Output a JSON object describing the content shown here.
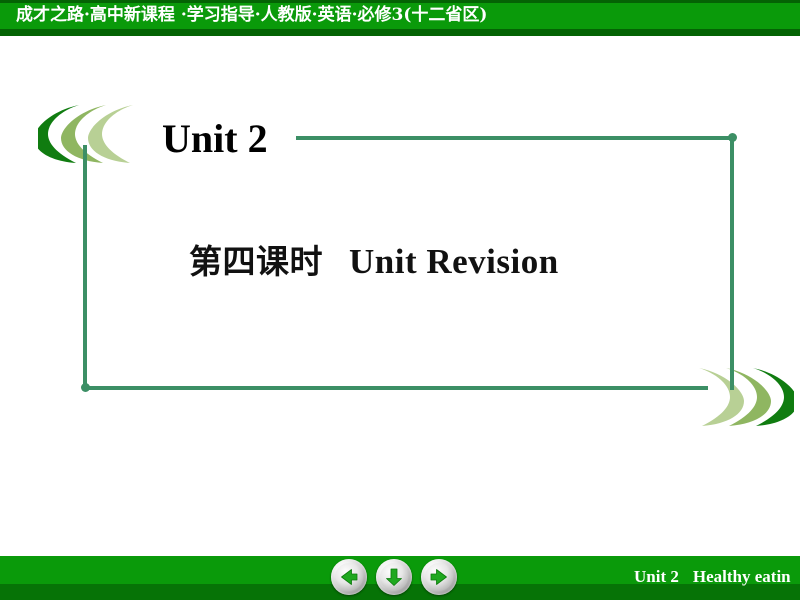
{
  "header": {
    "title": "成才之路·高中新课程 ·学习指导·人教版·英语·必修3(十二省区)",
    "band_color": "#0A9A0A",
    "border_color": "#046304"
  },
  "body": {
    "unit_heading": "Unit 2",
    "lesson_number": "第四课时",
    "lesson_name": "Unit Revision",
    "frame_color": "#3C8F65"
  },
  "decorations": {
    "crescent_colors": [
      "#107C10",
      "#8FB661",
      "#B8D095"
    ],
    "left_group_name": "left-crescent-decoration",
    "right_group_name": "right-crescent-decoration"
  },
  "footer": {
    "unit_label": "Unit 2",
    "topic_label": "Healthy eatin",
    "band_color": "#0A9A0A",
    "shadow_color": "#067306",
    "buttons": [
      {
        "name": "previous-slide-button",
        "icon": "arrow-left-icon"
      },
      {
        "name": "down-slide-button",
        "icon": "arrow-down-icon"
      },
      {
        "name": "next-slide-button",
        "icon": "arrow-right-icon"
      }
    ]
  }
}
